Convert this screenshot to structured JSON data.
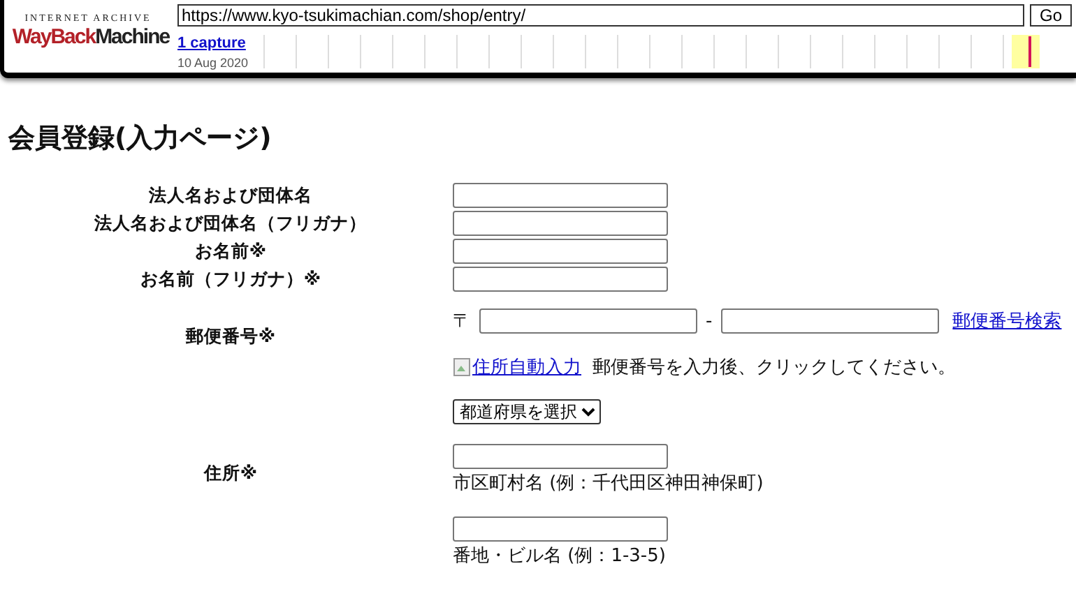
{
  "toolbar": {
    "logo_top": "INTERNET ARCHIVE",
    "logo_way": "WayBack",
    "logo_machine": "Machine",
    "url": "https://www.kyo-tsukimachian.com/shop/entry/",
    "go_button": "Go",
    "captures_link": "1 capture",
    "capture_date": "10 Aug 2020"
  },
  "form": {
    "title": "会員登録(入力ページ)",
    "rows": [
      {
        "label": "法人名および団体名",
        "kind": "text"
      },
      {
        "label": "法人名および団体名（フリガナ）",
        "kind": "text"
      },
      {
        "label": "お名前※",
        "kind": "text"
      },
      {
        "label": "お名前（フリガナ）※",
        "kind": "text"
      }
    ],
    "postal": {
      "label": "郵便番号※",
      "mark": "〒",
      "dash": "-",
      "search_link": "郵便番号検索",
      "auto_fill_link": "住所自動入力",
      "auto_fill_hint": "郵便番号を入力後、クリックしてください。"
    },
    "address": {
      "label": "住所※",
      "prefecture_select": "都道府県を選択",
      "city_caption": "市区町村名 (例：千代田区神田神保町)",
      "street_caption": "番地・ビル名 (例：1-3-5)"
    }
  }
}
